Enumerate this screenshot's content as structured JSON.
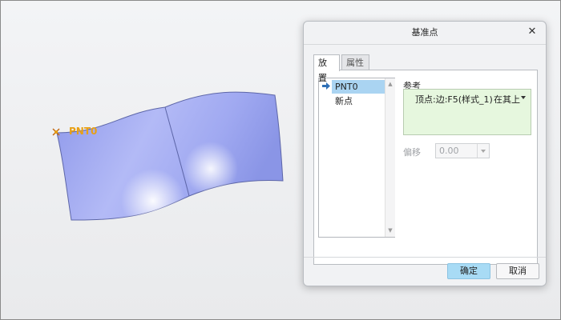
{
  "viewport": {
    "point_label": "PNT0",
    "colors": {
      "surface": "#aab2f4",
      "point_label": "#e8a015",
      "background": "#eeeff1"
    }
  },
  "dialog": {
    "title": "基准点",
    "close_glyph": "✕",
    "tabs": [
      {
        "label": "放置",
        "active": true
      },
      {
        "label": "属性",
        "active": false
      }
    ],
    "point_list": {
      "items": [
        {
          "label": "PNT0",
          "selected": true
        },
        {
          "label": "新点",
          "selected": false
        }
      ]
    },
    "reference": {
      "label": "参考",
      "entry": "顶点:边:F5(样式_1)",
      "constraint": "在其上"
    },
    "offset": {
      "label": "偏移",
      "value": "0.00"
    },
    "buttons": {
      "ok": "确定",
      "cancel": "取消"
    },
    "colors": {
      "selection": "#aad4f2",
      "reference_box": "#e6f7de",
      "ok_button": "#a8dbf5"
    }
  }
}
